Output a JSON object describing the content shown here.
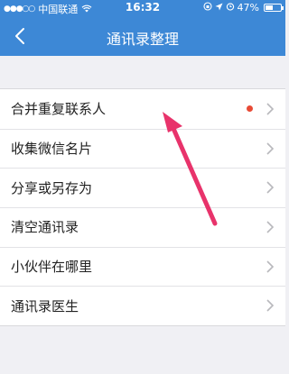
{
  "status_bar": {
    "carrier": "中国联通",
    "time": "16:32",
    "battery_percent": "47%",
    "battery_level": 0.47
  },
  "navbar": {
    "title": "通讯录整理"
  },
  "menu": {
    "items": [
      {
        "label": "合并重复联系人",
        "has_badge": true
      },
      {
        "label": "收集微信名片",
        "has_badge": false
      },
      {
        "label": "分享或另存为",
        "has_badge": false
      },
      {
        "label": "清空通讯录",
        "has_badge": false
      },
      {
        "label": "小伙伴在哪里",
        "has_badge": false
      },
      {
        "label": "通讯录医生",
        "has_badge": false
      }
    ]
  },
  "colors": {
    "header": "#3d88d6",
    "badge": "#e84a35",
    "annotation_arrow": "#e8336b"
  }
}
